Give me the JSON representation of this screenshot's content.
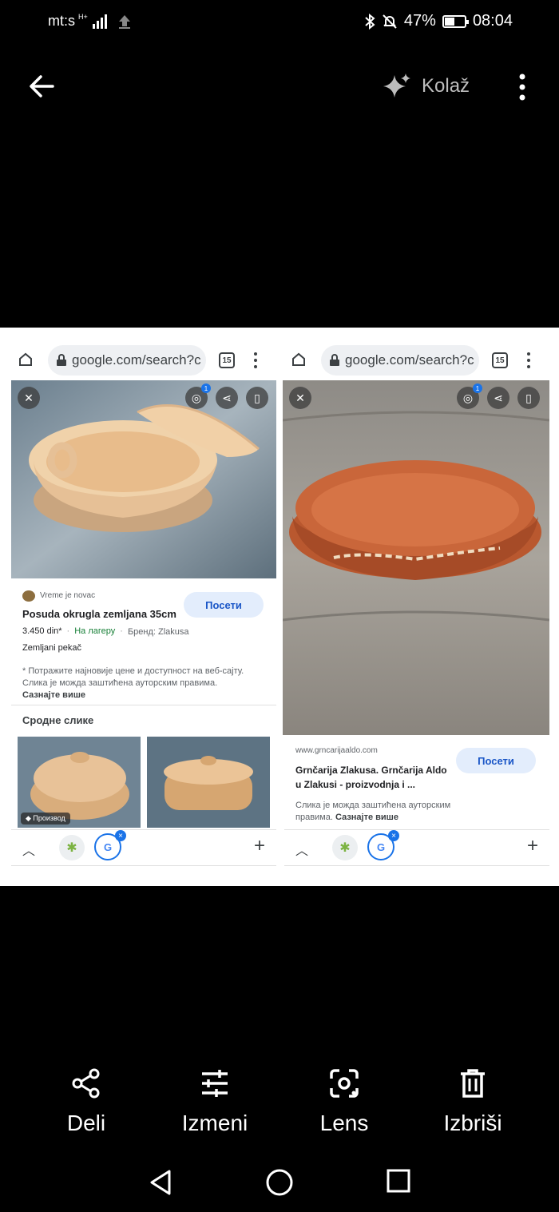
{
  "status_bar": {
    "carrier": "mt:s",
    "network": "H+",
    "battery": "47%",
    "time": "08:04"
  },
  "top_bar": {
    "collage_label": "Kolaž"
  },
  "screenshot": {
    "left_panel": {
      "url": "google.com/search?c",
      "tab_count": "15",
      "lens_badge": "1",
      "source_name": "Vreme je novac",
      "title": "Posuda okrugla zemljana 35cm",
      "price": "3.450 din*",
      "stock": "На лагеру",
      "brand": "Бренд: Zlakusa",
      "category": "Zemljani pekač",
      "visit_label": "Посети",
      "disclaimer": "* Потражите најновије цене и доступност на веб-сајту. Слика је можда заштићена ауторским правима.",
      "learn_more": "Сазнајте више",
      "related_title": "Сродне слике",
      "product_tag": "Производ"
    },
    "right_panel": {
      "url": "google.com/search?c",
      "tab_count": "15",
      "lens_badge": "1",
      "source_url": "www.grncarijaaldo.com",
      "title": "Grnčarija Zlakusa. Grnčarija Aldo u Zlakusi - proizvodnja i ...",
      "visit_label": "Посети",
      "disclaimer": "Слика је можда заштићена ауторским правима.",
      "learn_more": "Сазнајте више"
    }
  },
  "actions": [
    {
      "label": "Deli",
      "icon": "share-icon"
    },
    {
      "label": "Izmeni",
      "icon": "tune-icon"
    },
    {
      "label": "Lens",
      "icon": "lens-icon"
    },
    {
      "label": "Izbriši",
      "icon": "trash-icon"
    }
  ],
  "nav": [
    "back",
    "home",
    "recents"
  ]
}
